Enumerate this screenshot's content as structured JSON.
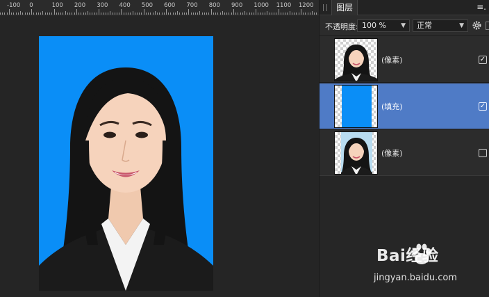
{
  "ruler": {
    "labels": [
      "-100",
      "0",
      "100",
      "200",
      "300",
      "400",
      "500",
      "600",
      "700",
      "800",
      "900",
      "1000",
      "1100",
      "1200"
    ]
  },
  "panel": {
    "tab_label": "图层",
    "menu_icon": "hamburger-menu-icon",
    "opacity_label": "不透明度:",
    "opacity_value": "100 %",
    "blend_mode": "正常"
  },
  "layers": [
    {
      "name": "(像素)",
      "visible": true,
      "selected": false,
      "thumb": "portrait-transparent"
    },
    {
      "name": "(填充)",
      "visible": true,
      "selected": true,
      "thumb": "blue-fill"
    },
    {
      "name": "(像素)",
      "visible": false,
      "selected": false,
      "thumb": "portrait-light-blue"
    }
  ],
  "canvas": {
    "background_color": "#0a8ef7"
  },
  "watermark": {
    "brand": "Bai经验",
    "url": "jingyan.baidu.com"
  }
}
